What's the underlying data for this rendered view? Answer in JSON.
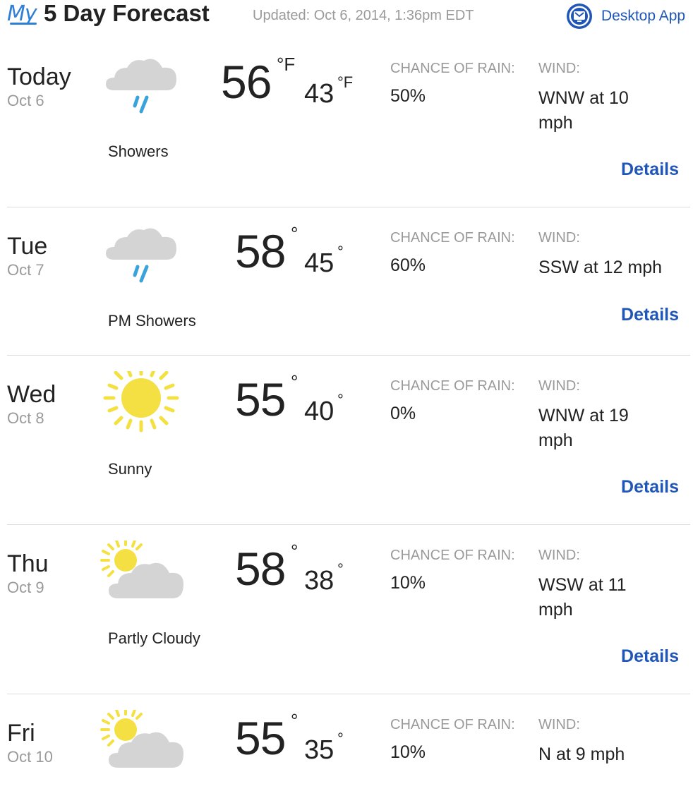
{
  "header": {
    "logo_text": "My",
    "title": "5 Day Forecast",
    "updated": "Updated: Oct 6, 2014, 1:36pm EDT",
    "desktop_app_label": "Desktop App",
    "desktop_app_icon": "desktop-app-icon",
    "brand_color": "#1f56b8",
    "logo_color": "#2f7fd6"
  },
  "forecast": [
    {
      "day": "Today",
      "date": "Oct 6",
      "icon": "rain-cloud-icon",
      "condition": "Showers",
      "high": "56",
      "high_unit": "°F",
      "low": "43",
      "low_unit": "°F",
      "rain_label": "CHANCE OF RAIN:",
      "rain": "50%",
      "wind_label": "WIND:",
      "wind": "WNW at 10 mph",
      "details": "Details"
    },
    {
      "day": "Tue",
      "date": "Oct 7",
      "icon": "rain-cloud-icon",
      "condition": "PM Showers",
      "high": "58",
      "high_unit": "°",
      "low": "45",
      "low_unit": "°",
      "rain_label": "CHANCE OF RAIN:",
      "rain": "60%",
      "wind_label": "WIND:",
      "wind": "SSW at 12 mph",
      "details": "Details"
    },
    {
      "day": "Wed",
      "date": "Oct 8",
      "icon": "sun-icon",
      "condition": "Sunny",
      "high": "55",
      "high_unit": "°",
      "low": "40",
      "low_unit": "°",
      "rain_label": "CHANCE OF RAIN:",
      "rain": "0%",
      "wind_label": "WIND:",
      "wind": "WNW at 19 mph",
      "details": "Details"
    },
    {
      "day": "Thu",
      "date": "Oct 9",
      "icon": "partly-cloudy-icon",
      "condition": "Partly Cloudy",
      "high": "58",
      "high_unit": "°",
      "low": "38",
      "low_unit": "°",
      "rain_label": "CHANCE OF RAIN:",
      "rain": "10%",
      "wind_label": "WIND:",
      "wind": "WSW at 11 mph",
      "details": "Details"
    },
    {
      "day": "Fri",
      "date": "Oct 10",
      "icon": "partly-cloudy-icon",
      "condition": "",
      "high": "55",
      "high_unit": "°",
      "low": "35",
      "low_unit": "°",
      "rain_label": "CHANCE OF RAIN:",
      "rain": "10%",
      "wind_label": "WIND:",
      "wind": "N at 9 mph",
      "details": ""
    }
  ]
}
